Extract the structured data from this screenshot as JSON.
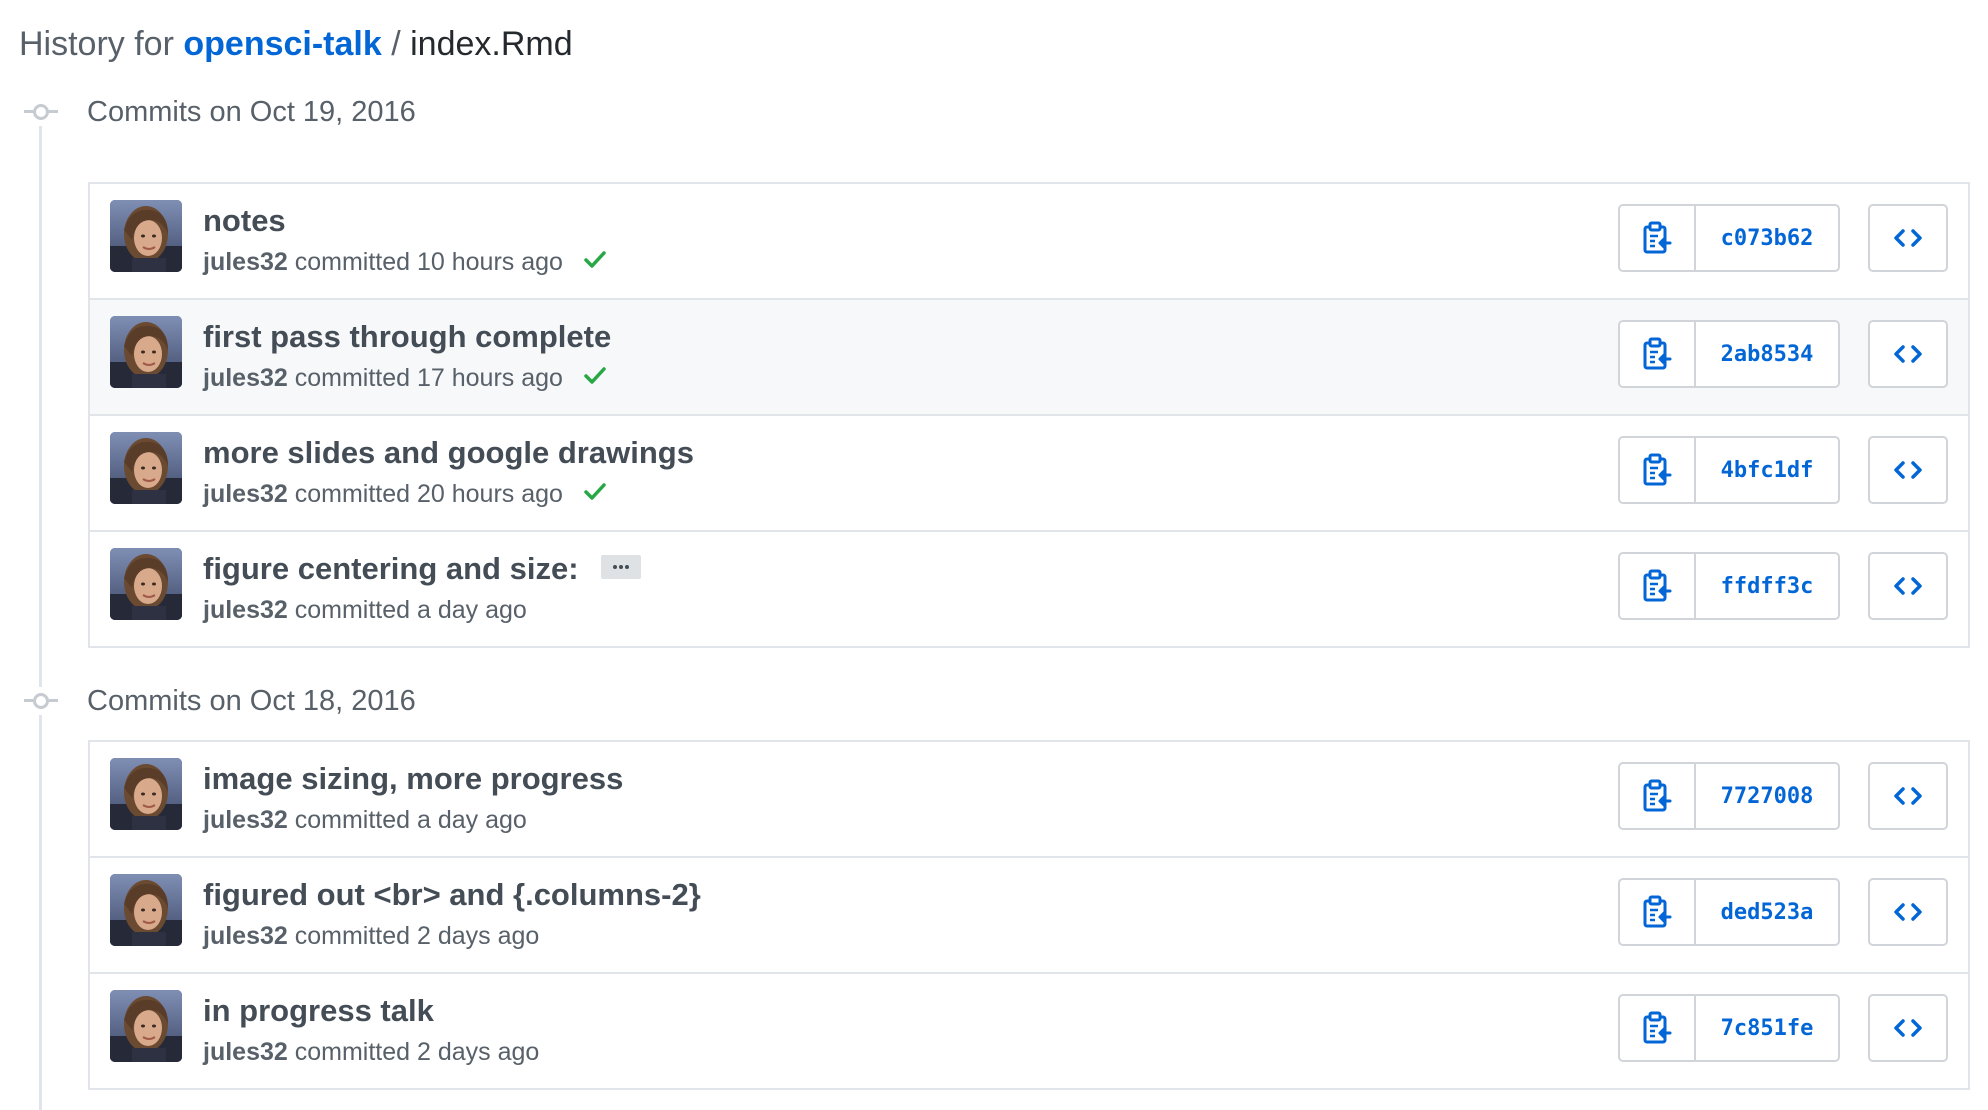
{
  "header": {
    "prefix": "History for",
    "repo": "opensci-talk",
    "separator": "/",
    "file": "index.Rmd"
  },
  "groups": [
    {
      "title": "Commits on Oct 19, 2016",
      "commits": [
        {
          "message": "notes",
          "author": "jules32",
          "verb": "committed",
          "time": "10 hours ago",
          "sha": "c073b62",
          "status": "success"
        },
        {
          "message": "first pass through complete",
          "author": "jules32",
          "verb": "committed",
          "time": "17 hours ago",
          "sha": "2ab8534",
          "status": "success"
        },
        {
          "message": "more slides and google drawings",
          "author": "jules32",
          "verb": "committed",
          "time": "20 hours ago",
          "sha": "4bfc1df",
          "status": "success"
        },
        {
          "message": "figure centering and size:",
          "author": "jules32",
          "verb": "committed",
          "time": "a day ago",
          "sha": "ffdff3c",
          "status": ""
        }
      ]
    },
    {
      "title": "Commits on Oct 18, 2016",
      "commits": [
        {
          "message": "image sizing, more progress",
          "author": "jules32",
          "verb": "committed",
          "time": "a day ago",
          "sha": "7727008",
          "status": ""
        },
        {
          "message": "figured out <br> and {.columns-2}",
          "author": "jules32",
          "verb": "committed",
          "time": "2 days ago",
          "sha": "ded523a",
          "status": ""
        },
        {
          "message": "in progress talk",
          "author": "jules32",
          "verb": "committed",
          "time": "2 days ago",
          "sha": "7c851fe",
          "status": ""
        }
      ]
    }
  ],
  "icons": {
    "copy": "clippy-icon",
    "browse": "code-icon",
    "status_success": "check-icon",
    "timeline": "git-commit-icon",
    "expand": "ellipsis-icon"
  },
  "colors": {
    "link": "#0366d6",
    "success": "#28a745",
    "border": "#e1e4e8",
    "highlight_row": "#f6f8fa"
  }
}
